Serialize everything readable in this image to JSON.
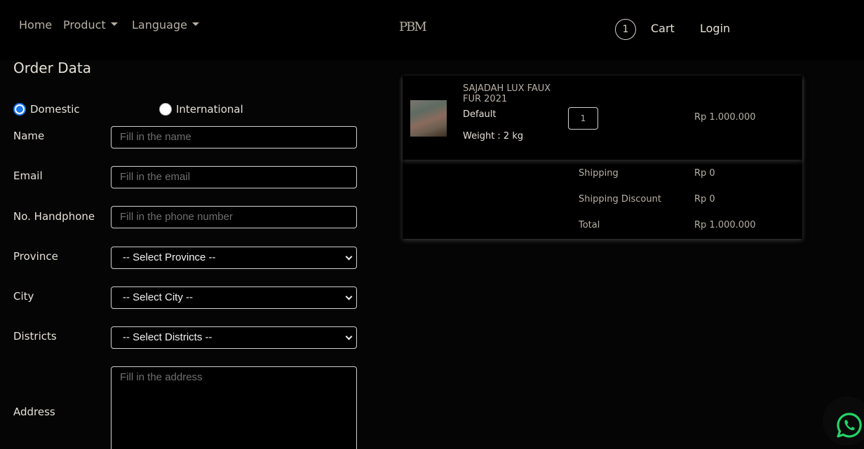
{
  "nav": {
    "home": "Home",
    "product": "Product",
    "language": "Language",
    "logo": "PBM",
    "cart_count": "1",
    "cart": "Cart",
    "login": "Login"
  },
  "form": {
    "title": "Order Data",
    "radio_domestic": "Domestic",
    "radio_international": "International",
    "shipping_type_selected": "Domestic",
    "name_label": "Name",
    "name_placeholder": "Fill in the name",
    "email_label": "Email",
    "email_placeholder": "Fill in the email",
    "phone_label": "No. Handphone",
    "phone_placeholder": "Fill in the phone number",
    "province_label": "Province",
    "province_value": "-- Select Province --",
    "city_label": "City",
    "city_value": "-- Select City --",
    "districts_label": "Districts",
    "districts_value": "-- Select Districts --",
    "address_label": "Address",
    "address_placeholder": "Fill in the address"
  },
  "order": {
    "item": {
      "name": "SAJADAH LUX FAUX FUR 2021",
      "variant": "Default",
      "weight": "Weight : 2 kg",
      "quantity": "1",
      "price": "Rp 1.000.000"
    },
    "summary": {
      "shipping_label": "Shipping",
      "shipping_value": "Rp 0",
      "discount_label": "Shipping Discount",
      "discount_value": "Rp 0",
      "total_label": "Total",
      "total_value": "Rp 1.000.000"
    }
  },
  "colors": {
    "background": "#050505",
    "text": "#e6e0d6",
    "muted": "#b7b0a4",
    "radio_accent": "#1a73e8",
    "whatsapp": "#25d366"
  },
  "icons": {
    "whatsapp": "whatsapp-icon",
    "product_caret": "chevron-down-icon",
    "select_arrow": "chevron-down-icon"
  }
}
